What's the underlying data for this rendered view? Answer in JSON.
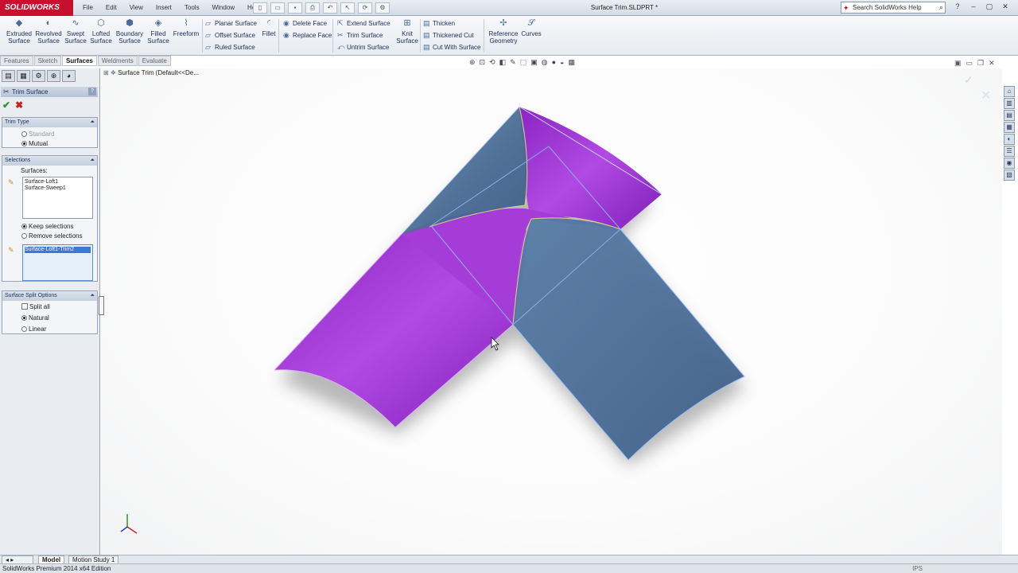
{
  "app": {
    "logo": "SOLIDWORKS",
    "menu": [
      "File",
      "Edit",
      "View",
      "Insert",
      "Tools",
      "Window",
      "Help"
    ],
    "document_title": "Surface Trim.SLDPRT *",
    "search_placeholder": "Search SolidWorks Help"
  },
  "toolbar": {
    "big_buttons": [
      {
        "label1": "Extruded",
        "label2": "Surface"
      },
      {
        "label1": "Revolved",
        "label2": "Surface"
      },
      {
        "label1": "Swept",
        "label2": "Surface"
      },
      {
        "label1": "Lofted",
        "label2": "Surface"
      },
      {
        "label1": "Boundary",
        "label2": "Surface"
      },
      {
        "label1": "Filled",
        "label2": "Surface"
      },
      {
        "label1": "Freeform",
        "label2": ""
      }
    ],
    "planar_surface": "Planar Surface",
    "offset_surface": "Offset Surface",
    "ruled_surface": "Ruled Surface",
    "fillet": "Fillet",
    "delete_face": "Delete Face",
    "replace_face": "Replace Face",
    "extend_surface": "Extend Surface",
    "trim_surface": "Trim Surface",
    "untrim_surface": "Untrim Surface",
    "knit_surface_1": "Knit",
    "knit_surface_2": "Surface",
    "thicken": "Thicken",
    "thickened_cut": "Thickened Cut",
    "cut_with_surface": "Cut With Surface",
    "reference_geometry_1": "Reference",
    "reference_geometry_2": "Geometry",
    "curves": "Curves"
  },
  "tabs": [
    {
      "label": "Features",
      "active": false
    },
    {
      "label": "Sketch",
      "active": false
    },
    {
      "label": "Surfaces",
      "active": true
    },
    {
      "label": "Weldments",
      "active": false
    },
    {
      "label": "Evaluate",
      "active": false
    }
  ],
  "property_manager": {
    "title": "Trim Surface",
    "trim_type": {
      "header": "Trim Type",
      "standard": "Standard",
      "mutual": "Mutual",
      "selected": "Mutual"
    },
    "selections": {
      "header": "Selections",
      "surfaces_label": "Surfaces:",
      "surfaces": [
        "Surface-Loft1",
        "Surface-Sweep1"
      ],
      "keep_selections": "Keep selections",
      "remove_selections": "Remove selections",
      "selected": "Keep selections",
      "pieces": [
        "Surface-Loft1-Trim2"
      ]
    },
    "split_options": {
      "header": "Surface Split Options",
      "split_all": "Split all",
      "split_all_checked": false,
      "natural": "Natural",
      "linear": "Linear",
      "selected": "Natural"
    }
  },
  "tree_crumb": "Surface Trim  (Default<<De...",
  "bottom_tabs": [
    {
      "label": "Model",
      "active": true
    },
    {
      "label": "Motion Study 1",
      "active": false
    }
  ],
  "status": {
    "edition": "SolidWorks Premium 2014 x64 Edition",
    "units": "IPS"
  },
  "colors": {
    "trim_kept": "#a23ad8",
    "trim_preview": "#4d6f9a",
    "brand": "#c8102e"
  }
}
